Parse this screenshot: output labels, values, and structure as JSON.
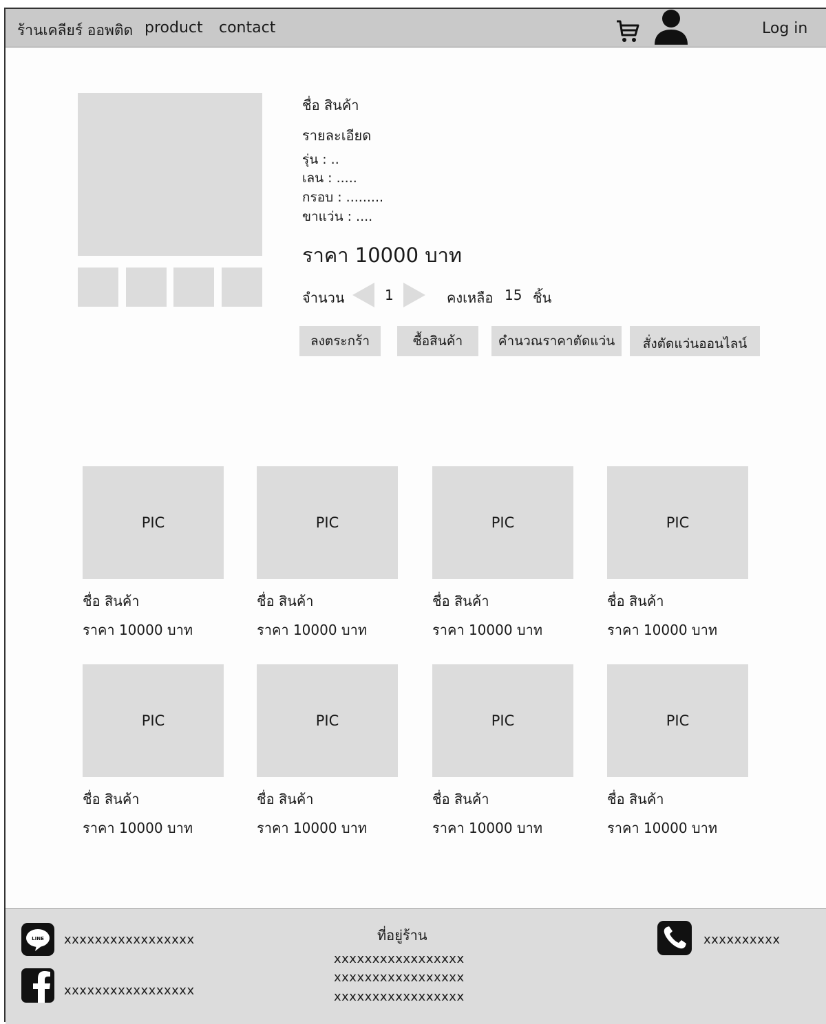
{
  "header": {
    "brand": "ร้านเคลียร์ ออพติด",
    "nav": {
      "product": "product",
      "contact": "contact"
    },
    "login": "Log in",
    "icons": {
      "cart": "cart-icon",
      "user": "user-icon"
    }
  },
  "product": {
    "name": "ชื่อ สินค้า",
    "description_title": "รายละเอียด",
    "specs": {
      "model": "รุ่น : ..",
      "lens": "เลน : .....",
      "frame": "กรอบ : .........",
      "legs": "ขาแว่น : ...."
    },
    "price": "ราคา 10000 บาท",
    "quantity_label": "จำนวน",
    "quantity": "1",
    "stock_label": "คงเหลือ",
    "stock": "15",
    "stock_unit": "ชิ้น",
    "buttons": {
      "add_to_cart": "ลงตระกร้า",
      "buy": "ซื้อสินค้า",
      "calc_price": "คำนวณราคาตัดแว่น",
      "order_online": "สั่งตัดแว่นออนไลน์"
    }
  },
  "grid": [
    {
      "pic": "PIC",
      "name": "ชื่อ สินค้า",
      "price": "ราคา 10000 บาท"
    },
    {
      "pic": "PIC",
      "name": "ชื่อ สินค้า",
      "price": "ราคา 10000 บาท"
    },
    {
      "pic": "PIC",
      "name": "ชื่อ สินค้า",
      "price": "ราคา 10000 บาท"
    },
    {
      "pic": "PIC",
      "name": "ชื่อ สินค้า",
      "price": "ราคา 10000 บาท"
    },
    {
      "pic": "PIC",
      "name": "ชื่อ สินค้า",
      "price": "ราคา 10000 บาท"
    },
    {
      "pic": "PIC",
      "name": "ชื่อ สินค้า",
      "price": "ราคา 10000 บาท"
    },
    {
      "pic": "PIC",
      "name": "ชื่อ สินค้า",
      "price": "ราคา 10000 บาท"
    },
    {
      "pic": "PIC",
      "name": "ชื่อ สินค้า",
      "price": "ราคา 10000 บาท"
    }
  ],
  "footer": {
    "line": "xxxxxxxxxxxxxxxxx",
    "facebook": "xxxxxxxxxxxxxxxxx",
    "address_title": "ที่อยู่ร้าน",
    "address": [
      "xxxxxxxxxxxxxxxxx",
      "xxxxxxxxxxxxxxxxx",
      "xxxxxxxxxxxxxxxxx"
    ],
    "phone": "xxxxxxxxxx",
    "icons": {
      "line": "line-icon",
      "facebook": "facebook-icon",
      "phone": "phone-icon"
    }
  }
}
